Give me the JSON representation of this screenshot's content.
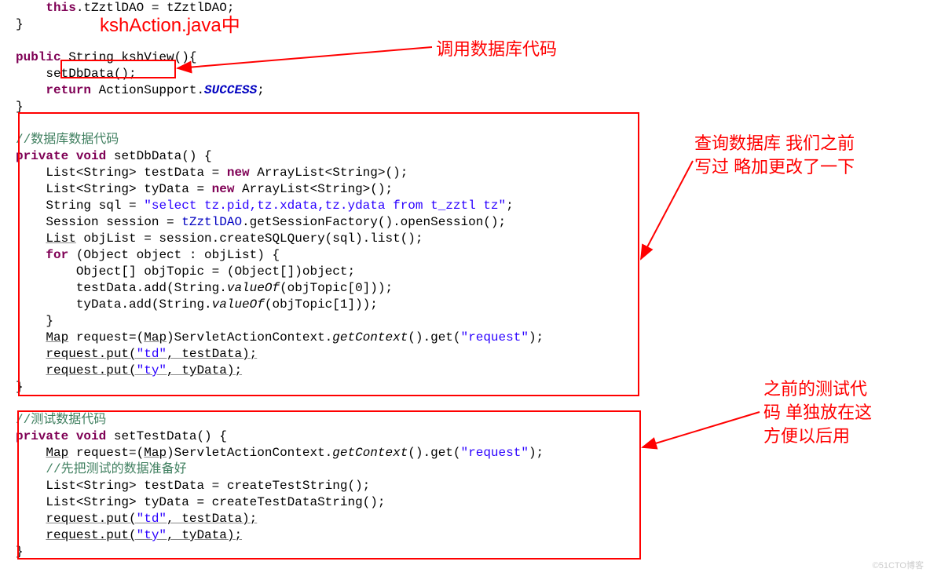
{
  "annotations": {
    "title": "kshAction.java中",
    "label1": "调用数据库代码",
    "label2_line1": "查询数据库 我们之前",
    "label2_line2": "写过 略加更改了一下",
    "label3_line1": "之前的测试代",
    "label3_line2": "码 单独放在这",
    "label3_line3": "方便以后用"
  },
  "code": {
    "l1": "this.tZztlDAO = tZztlDAO;",
    "l2": "}",
    "l3": "",
    "l4_public": "public",
    "l4_rest": " String kshView(){",
    "l5": "setDbData();",
    "l6_return": "return",
    "l6_rest": " ActionSupport.",
    "l6_success": "SUCCESS",
    "l6_semi": ";",
    "l7": "}",
    "l8": "",
    "c1_comment": "//数据库数据代码",
    "c2_private": "private",
    "c2_void": " void",
    "c2_rest": " setDbData() {",
    "c3a": "    List<String> testData = ",
    "c3_new": "new",
    "c3b": " ArrayList<String>();",
    "c4a": "    List<String> tyData = ",
    "c4_new": "new",
    "c4b": " ArrayList<String>();",
    "c5a": "    String sql = ",
    "c5_str": "\"select tz.pid,tz.xdata,tz.ydata from t_zztl tz\"",
    "c5b": ";",
    "c6": "    Session session = tZztlDAO.getSessionFactory().openSession();",
    "c7": "    List objList = session.createSQLQuery(sql).list();",
    "c8_for": "for",
    "c8a": " (Object object : objList) {",
    "c9": "        Object[] objTopic = (Object[])object;",
    "c10a": "        testData.add(String.",
    "c10_val": "valueOf",
    "c10b": "(objTopic[0]));",
    "c11a": "        tyData.add(String.",
    "c11_val": "valueOf",
    "c11b": "(objTopic[1]));",
    "c12": "    }",
    "c13a": "    Map request=(Map)ServletActionContext.",
    "c13_gc": "getContext",
    "c13b": "().get(",
    "c13_str": "\"request\"",
    "c13c": ");",
    "c14a": "    request.put(",
    "c14_str": "\"td\"",
    "c14b": ", testData);",
    "c15a": "    request.put(",
    "c15_str": "\"ty\"",
    "c15b": ", tyData);",
    "c16": "}",
    "t1_comment": "//测试数据代码",
    "t2_private": "private",
    "t2_void": " void",
    "t2_rest": " setTestData() {",
    "t3a": "    Map request=(Map)ServletActionContext.",
    "t3_gc": "getContext",
    "t3b": "().get(",
    "t3_str": "\"request\"",
    "t3c": ");",
    "t4_comment": "    //先把测试的数据准备好",
    "t5": "    List<String> testData = createTestString();",
    "t6": "    List<String> tyData = createTestDataString();",
    "t7a": "    request.put(",
    "t7_str": "\"td\"",
    "t7b": ", testData);",
    "t8a": "    request.put(",
    "t8_str": "\"ty\"",
    "t8b": ", tyData);",
    "t9": "}"
  },
  "watermark": "©51CTO博客"
}
